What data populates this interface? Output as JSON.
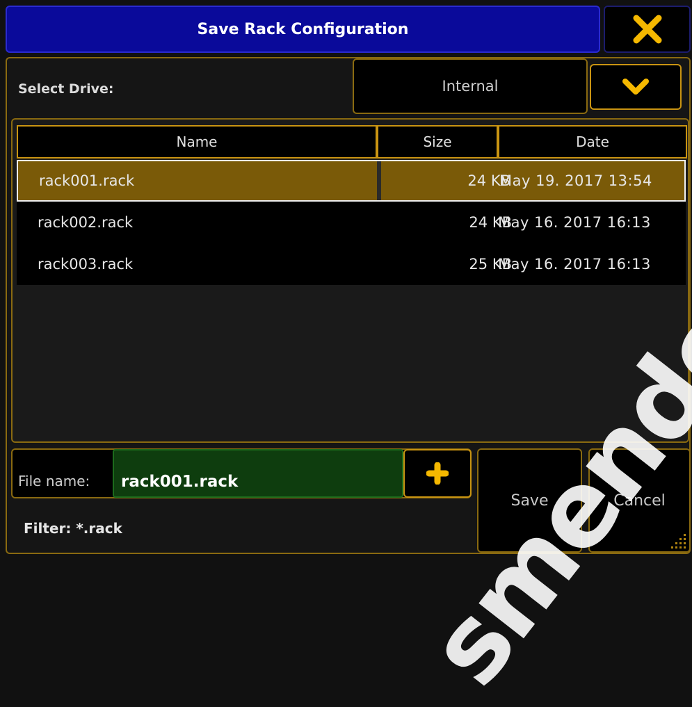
{
  "dialog": {
    "title": "Save Rack Configuration",
    "close_icon": "close-x-icon"
  },
  "drive": {
    "label": "Select Drive:",
    "value": "Internal",
    "dropdown_icon": "chevron-down-icon"
  },
  "table": {
    "columns": [
      "Name",
      "Size",
      "Date"
    ],
    "rows": [
      {
        "name": "rack001.rack",
        "size": "24 KB",
        "date": "May 19. 2017 13:54",
        "selected": true
      },
      {
        "name": "rack002.rack",
        "size": "24 KB",
        "date": "May 16. 2017 16:13",
        "selected": false
      },
      {
        "name": "rack003.rack",
        "size": "25 KB",
        "date": "May 16. 2017 16:13",
        "selected": false
      }
    ]
  },
  "file": {
    "label": "File name:",
    "value": "rack001.rack",
    "add_icon": "plus-icon"
  },
  "filter": "Filter: *.rack",
  "buttons": {
    "save": "Save",
    "cancel": "Cancel"
  },
  "watermark": "smendoza.com",
  "colors": {
    "accent": "#c99412",
    "title_bg": "#0a0a9a",
    "selected_row": "#7a5a08",
    "input_bg": "#0e3d0e"
  }
}
